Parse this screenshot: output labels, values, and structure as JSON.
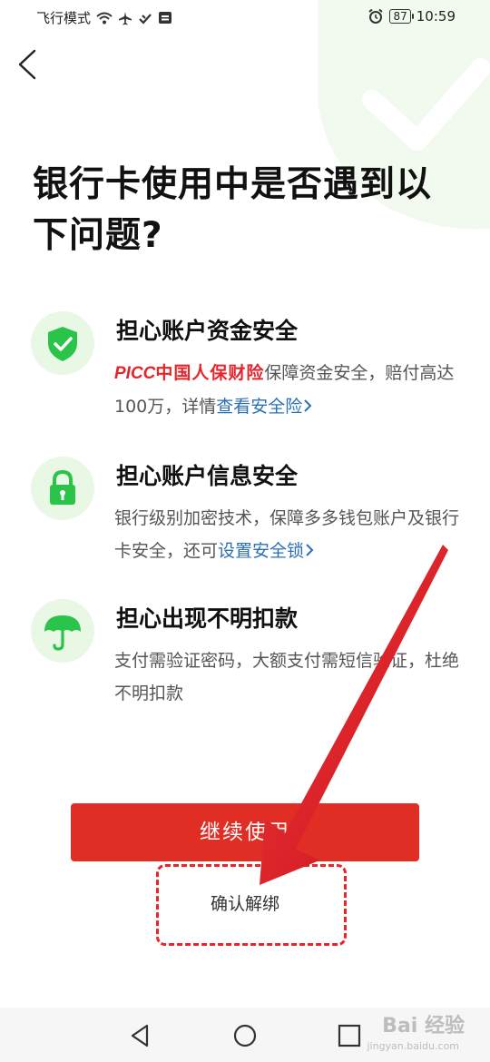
{
  "status_bar": {
    "left_text": "飞行模式",
    "battery": "87",
    "time": "10:59",
    "icons": [
      "wifi-icon",
      "airplane-icon",
      "link-icon",
      "sim-icon",
      "alarm-icon",
      "battery-icon"
    ]
  },
  "title": "银行卡使用中是否遇到以下问题?",
  "items": [
    {
      "icon": "shield-check-icon",
      "title": "担心账户资金安全",
      "brand_latin": "PICC",
      "brand_cn": "中国人保财险",
      "desc_before": "保障资金安全，赔付高达100万，详情",
      "link": "查看安全险"
    },
    {
      "icon": "lock-icon",
      "title": "担心账户信息安全",
      "desc_before": "银行级别加密技术，保障多多钱包账户及银行卡安全，还可",
      "link": "设置安全锁"
    },
    {
      "icon": "umbrella-icon",
      "title": "担心出现不明扣款",
      "desc_before": "支付需验证密码，大额支付需短信验证，杜绝不明扣款"
    }
  ],
  "buttons": {
    "primary": "继续使用",
    "secondary": "确认解绑"
  },
  "watermark": {
    "main": "Bai 经验",
    "sub": "jingyan.baidu.com"
  },
  "colors": {
    "accent_red": "#e02e24",
    "icon_green": "#2bc44a",
    "link_blue": "#2b6fb6",
    "annotation_red": "#e8232a"
  }
}
